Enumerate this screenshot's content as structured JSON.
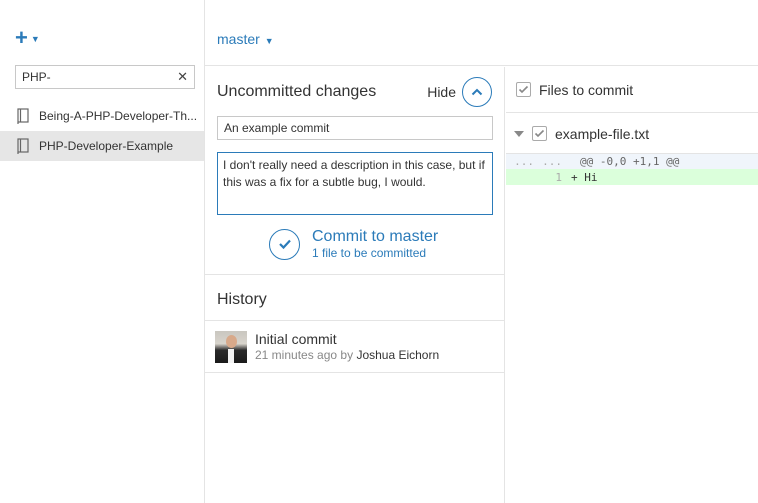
{
  "sidebar": {
    "search": {
      "value": "PHP-"
    },
    "repos": [
      {
        "name": "Being-A-PHP-Developer-Th...",
        "selected": false
      },
      {
        "name": "PHP-Developer-Example",
        "selected": true
      }
    ]
  },
  "topbar": {
    "branch": "master"
  },
  "changes": {
    "title": "Uncommitted changes",
    "hide_label": "Hide",
    "summary": "An example commit",
    "description": "I don't really need a description in this case, but if this was a fix for a subtle bug, I would.",
    "commit_label": "Commit to master",
    "commit_sub": "1 file to be committed"
  },
  "history": {
    "title": "History",
    "items": [
      {
        "message": "Initial commit",
        "time": "21 minutes ago",
        "by": "by",
        "author": "Joshua Eichorn"
      }
    ]
  },
  "files": {
    "header": "Files to commit",
    "list": [
      {
        "name": "example-file.txt",
        "checked": true
      }
    ],
    "diff": [
      {
        "type": "hunk",
        "old": "...",
        "new": "...",
        "text": "@@ -0,0 +1,1 @@"
      },
      {
        "type": "add",
        "old": "",
        "new": "1",
        "text": "+ Hi"
      }
    ]
  },
  "colors": {
    "accent": "#2b7bb9",
    "added_bg": "#dbffdb",
    "selected_bg": "#e6e6e6"
  }
}
